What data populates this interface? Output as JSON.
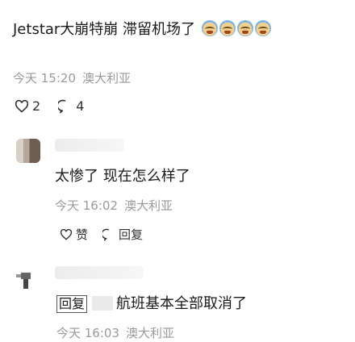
{
  "post": {
    "text": "Jetstar大崩特崩 滞留机场了",
    "emoji": [
      "loudly-crying-face",
      "loudly-crying-face",
      "loudly-crying-face",
      "loudly-crying-face"
    ],
    "time": "今天 15:20",
    "location": "澳大利亚",
    "likes": "2",
    "comments": "4"
  },
  "replies": [
    {
      "text": "太惨了 现在怎么样了",
      "time": "今天 16:02",
      "location": "澳大利亚",
      "like_label": "赞",
      "reply_label": "回复"
    },
    {
      "reply_tag": "回复",
      "text": "航班基本全部取消了",
      "time": "今天 16:03",
      "location": "澳大利亚"
    }
  ],
  "colors": {
    "meta": "#9a9a9a",
    "text": "#1a1a1a"
  }
}
